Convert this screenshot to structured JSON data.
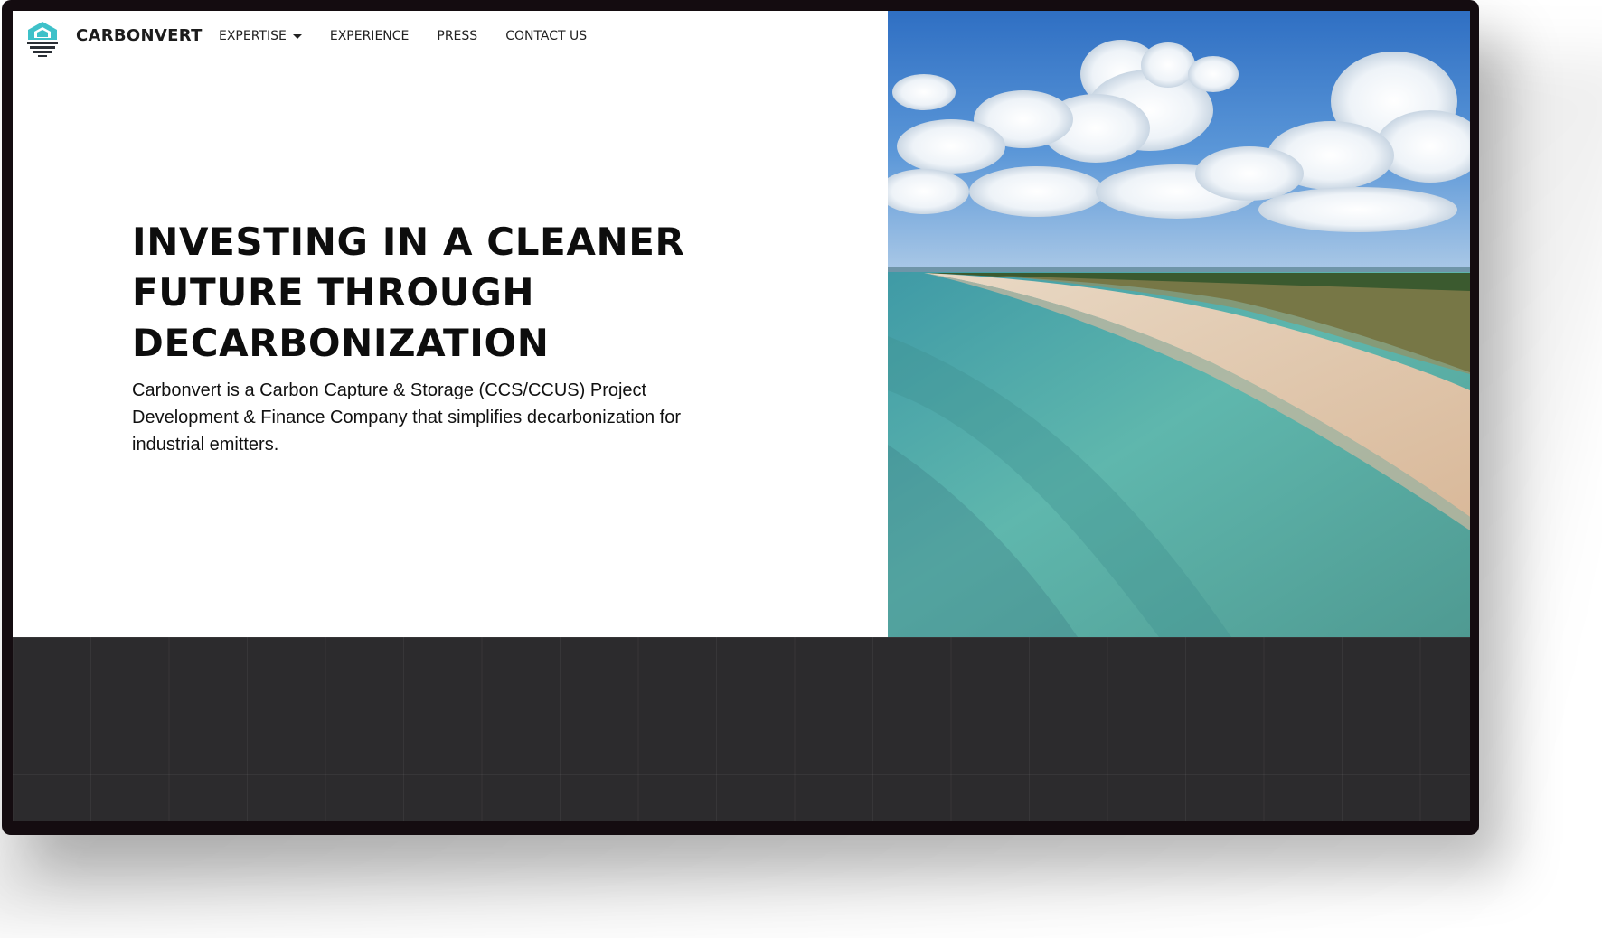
{
  "brand": {
    "name": "CARBONVERT",
    "logo_icon": "carbonvert-logo-icon"
  },
  "nav": {
    "items": [
      {
        "label": "EXPERTISE",
        "has_dropdown": true,
        "icon": "caret-down-icon"
      },
      {
        "label": "EXPERIENCE"
      },
      {
        "label": "PRESS"
      },
      {
        "label": "CONTACT US"
      }
    ]
  },
  "hero": {
    "headline_lines": [
      "INVESTING IN A CLEANER",
      "FUTURE THROUGH",
      "DECARBONIZATION"
    ],
    "description": "Carbonvert is a Carbon Capture & Storage (CCS/CCUS) Project Development & Finance Company that simplifies decarbonization for industrial emitters.",
    "image": "aerial-beach-coastline-photo"
  },
  "colors": {
    "logo_teal": "#3ec1c9",
    "logo_dark": "#2a2f35",
    "text_dark": "#0d0d0d",
    "footer_bg": "#2c2b2d",
    "device_frame": "#140c10"
  }
}
